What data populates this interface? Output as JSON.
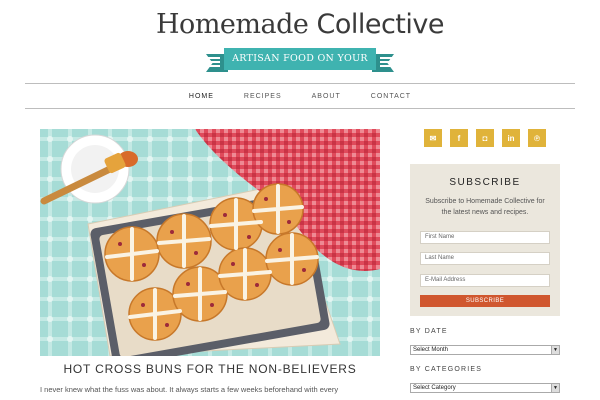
{
  "site": {
    "title_part1": "Homemade",
    "title_part2": "Collective",
    "tagline": "ARTISAN FOOD ON YOUR FORK"
  },
  "nav": {
    "items": [
      "HOME",
      "RECIPES",
      "ABOUT",
      "CONTACT"
    ],
    "active": "HOME"
  },
  "post": {
    "title": "HOT CROSS BUNS FOR THE NON-BELIEVERS",
    "excerpt": "I never knew what the fuss was about. It always starts a few weeks beforehand with every"
  },
  "social": {
    "icons": [
      "email-icon",
      "facebook-icon",
      "instagram-icon",
      "linkedin-icon",
      "pinterest-icon"
    ],
    "color": "#e0b33a"
  },
  "subscribe": {
    "title": "SUBSCRIBE",
    "text": "Subscribe to Homemade Collective for the latest news and recipes.",
    "first_name_placeholder": "First Name",
    "last_name_placeholder": "Last Name",
    "email_placeholder": "E-Mail Address",
    "button": "SUBSCRIBE",
    "button_color": "#d0572f"
  },
  "sidebar": {
    "by_date_heading": "BY DATE",
    "by_date_value": "Select Month",
    "by_category_heading": "BY CATEGORIES",
    "by_category_value": "Select Category"
  },
  "colors": {
    "accent_teal": "#3fb3b0",
    "hero_bg": "#a6dcd6"
  }
}
